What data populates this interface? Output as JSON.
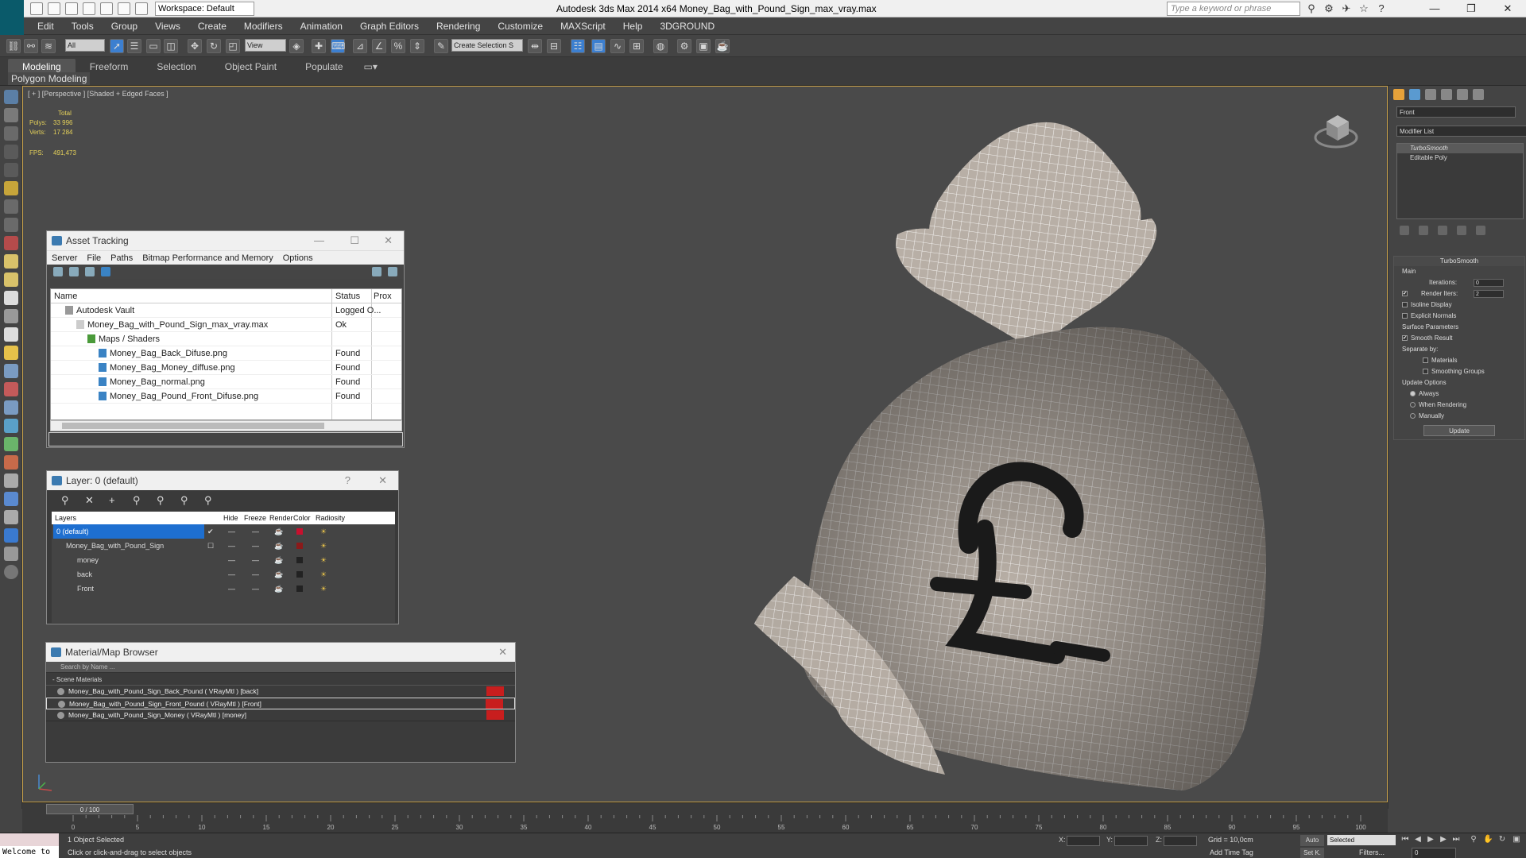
{
  "app": {
    "title": "Autodesk 3ds Max  2014 x64     Money_Bag_with_Pound_Sign_max_vray.max",
    "workspace": "Workspace: Default",
    "search_placeholder": "Type a keyword or phrase",
    "window_controls": [
      "—",
      "❐",
      "✕"
    ]
  },
  "menu": [
    "Edit",
    "Tools",
    "Group",
    "Views",
    "Create",
    "Modifiers",
    "Animation",
    "Graph Editors",
    "Rendering",
    "Customize",
    "MAXScript",
    "Help",
    "3DGROUND"
  ],
  "toolbar": {
    "selection_filter": "All",
    "reference_coord": "View",
    "named_selection": "Create Selection S"
  },
  "ribbon": {
    "tabs": [
      "Modeling",
      "Freeform",
      "Selection",
      "Object Paint",
      "Populate"
    ],
    "active_tab": "Modeling",
    "sub_label": "Polygon Modeling"
  },
  "viewport": {
    "label": "[ + ] [Perspective ] [Shaded + Edged Faces ]",
    "stats": {
      "total_label": "Total",
      "polys_label": "Polys:",
      "polys": "33 996",
      "verts_label": "Verts:",
      "verts": "17 284",
      "fps_label": "FPS:",
      "fps": "491,473"
    },
    "accent_color": "#c9a24b"
  },
  "asset_tracking": {
    "title": "Asset Tracking",
    "menu": [
      "Server",
      "File",
      "Paths",
      "Bitmap Performance and Memory",
      "Options"
    ],
    "columns": [
      "Name",
      "Status",
      "Prox"
    ],
    "rows": [
      {
        "name": "Autodesk Vault",
        "status": "Logged O..."
      },
      {
        "name": "Money_Bag_with_Pound_Sign_max_vray.max",
        "status": "Ok"
      },
      {
        "name": "Maps / Shaders",
        "status": ""
      },
      {
        "name": "Money_Bag_Back_Difuse.png",
        "status": "Found"
      },
      {
        "name": "Money_Bag_Money_diffuse.png",
        "status": "Found"
      },
      {
        "name": "Money_Bag_normal.png",
        "status": "Found"
      },
      {
        "name": "Money_Bag_Pound_Front_Difuse.png",
        "status": "Found"
      }
    ]
  },
  "layer_panel": {
    "title": "Layer: 0 (default)",
    "columns": [
      "Layers",
      "Hide",
      "Freeze",
      "Render",
      "Color",
      "Radiosity"
    ],
    "rows": [
      {
        "name": "0 (default)",
        "color": "#c8102e"
      },
      {
        "name": "Money_Bag_with_Pound_Sign",
        "color": "#8b1a1a"
      },
      {
        "name": "money",
        "color": "#222222"
      },
      {
        "name": "back",
        "color": "#222222"
      },
      {
        "name": "Front",
        "color": "#222222"
      }
    ]
  },
  "material_browser": {
    "title": "Material/Map Browser",
    "search_placeholder": "Search by Name ...",
    "section": "- Scene Materials",
    "items": [
      "Money_Bag_with_Pound_Sign_Back_Pound  ( VRayMtl ) [back]",
      "Money_Bag_with_Pound_Sign_Front_Pound  ( VRayMtl ) [Front]",
      "Money_Bag_with_Pound_Sign_Money  ( VRayMtl ) [money]"
    ]
  },
  "command_panel": {
    "object_name": "Front",
    "modifier_list": "Modifier List",
    "stack": [
      "TurboSmooth",
      "Editable Poly"
    ],
    "turbosmooth": {
      "title": "TurboSmooth",
      "main": "Main",
      "iterations_label": "Iterations:",
      "iterations": "0",
      "render_iters_label": "Render Iters:",
      "render_iters": "2",
      "isoline": "Isoline Display",
      "explicit": "Explicit Normals",
      "surface_params": "Surface Parameters",
      "smooth_result": "Smooth Result",
      "separate_by": "Separate by:",
      "materials": "Materials",
      "smoothing_groups": "Smoothing Groups",
      "update_options": "Update Options",
      "always": "Always",
      "when_rendering": "When Rendering",
      "manually": "Manually",
      "update_button": "Update"
    }
  },
  "timeline": {
    "frame_readout": "0 / 100",
    "ticks": [
      "0",
      "5",
      "10",
      "15",
      "20",
      "25",
      "30",
      "35",
      "40",
      "45",
      "50",
      "55",
      "60",
      "65",
      "70",
      "75",
      "80",
      "85",
      "90",
      "95",
      "100"
    ]
  },
  "status": {
    "welcome": "Welcome to",
    "selected": "1 Object Selected",
    "prompt": "Click or click-and-drag to select objects",
    "x_label": "X:",
    "y_label": "Y:",
    "z_label": "Z:",
    "grid": "Grid = 10,0cm",
    "add_time_tag": "Add Time Tag",
    "auto": "Auto",
    "set_key": "Set K.",
    "selected_mode": "Selected",
    "filters": "Filters...",
    "frame": "0"
  }
}
